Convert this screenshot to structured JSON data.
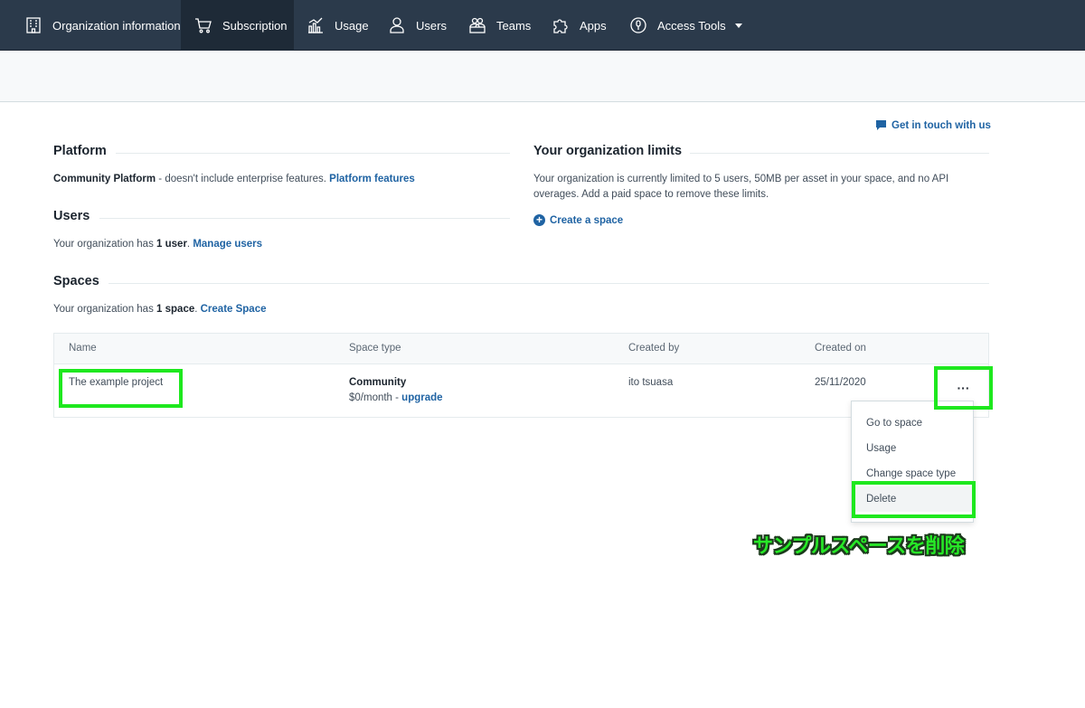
{
  "nav": {
    "items": [
      {
        "label": "Organization information",
        "icon": "building-icon"
      },
      {
        "label": "Subscription",
        "icon": "cart-icon",
        "active": true
      },
      {
        "label": "Usage",
        "icon": "bar-chart-icon"
      },
      {
        "label": "Users",
        "icon": "user-icon"
      },
      {
        "label": "Teams",
        "icon": "team-icon"
      },
      {
        "label": "Apps",
        "icon": "puzzle-icon"
      },
      {
        "label": "Access Tools",
        "icon": "key-icon"
      }
    ]
  },
  "contact": {
    "label": "Get in touch with us",
    "icon": "chat-icon"
  },
  "platform": {
    "title": "Platform",
    "name": "Community Platform",
    "description": " - doesn't include enterprise features. ",
    "link": "Platform features"
  },
  "users": {
    "title": "Users",
    "text_pre": "Your organization has ",
    "count": "1 user",
    "text_post": ". ",
    "link": "Manage users"
  },
  "limits": {
    "title": "Your organization limits",
    "line1": "Your organization is currently limited to 5 users, 50MB per asset in your space, and no API",
    "line2": "overages. Add a paid space to remove these limits.",
    "create_label": "Create a space"
  },
  "spaces": {
    "title": "Spaces",
    "text_pre": "Your organization has ",
    "count": "1 space",
    "text_post": ". ",
    "link": "Create Space",
    "columns": [
      "Name",
      "Space type",
      "Created by",
      "Created on"
    ],
    "rows": [
      {
        "name": "The example project",
        "type": "Community",
        "price": "$0/month - ",
        "upgrade": "upgrade",
        "created_by": "ito tsuasa",
        "created_on": "25/11/2020"
      }
    ],
    "actions_label": "···"
  },
  "menu": {
    "items": [
      "Go to space",
      "Usage",
      "Change space type",
      "Delete"
    ]
  },
  "annotation": "サンプルスペースを削除",
  "colors": {
    "nav_bg": "#2b3a4b",
    "link": "#1f63a3",
    "highlight": "#1ee81e"
  }
}
